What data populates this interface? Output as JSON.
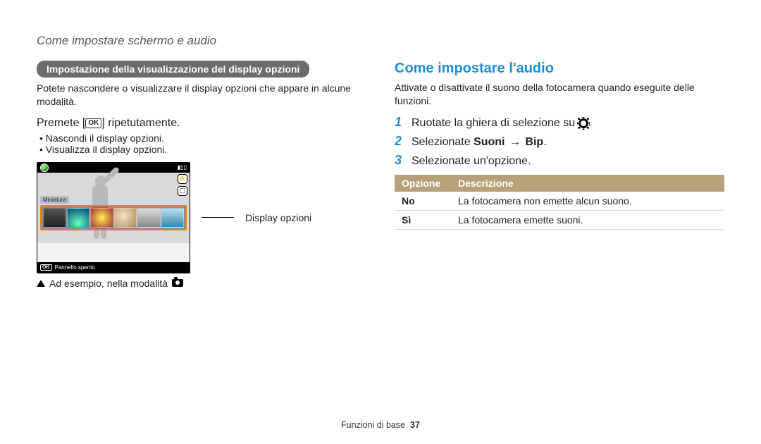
{
  "page_title": "Come impostare schermo e audio",
  "left": {
    "pill": "Impostazione della visualizzazione del display opzioni",
    "intro": "Potete nascondere o visualizzare il display opzioni che appare in alcune modalità.",
    "premete_prefix": "Premete [",
    "ok_label": "OK",
    "premete_suffix": "] ripetutamente.",
    "bullets": [
      "Nascondi il display opzioni.",
      "Visualizza il display opzioni."
    ],
    "screenshot": {
      "miniatura_label": "Miniatura",
      "bottom_ok": "OK",
      "bottom_text": "Pannello spento"
    },
    "callout_label": "Display opzioni",
    "caption_text": "Ad esempio, nella modalità"
  },
  "right": {
    "heading": "Come impostare l'audio",
    "intro": "Attivate o disattivate il suono della fotocamera quando eseguite delle funzioni.",
    "steps": {
      "s1_prefix": "Ruotate la ghiera di selezione su ",
      "s1_suffix": ".",
      "s2_prefix": "Selezionate ",
      "s2_bold_a": "Suoni",
      "s2_arrow": "→",
      "s2_bold_b": "Bip",
      "s2_suffix": ".",
      "s3": "Selezionate un'opzione."
    },
    "nums": {
      "n1": "1",
      "n2": "2",
      "n3": "3"
    },
    "table": {
      "th1": "Opzione",
      "th2": "Descrizione",
      "rows": [
        {
          "opt": "No",
          "desc": "La fotocamera non emette alcun suono."
        },
        {
          "opt": "Sì",
          "desc": "La fotocamera emette suoni."
        }
      ]
    }
  },
  "footer": {
    "label": "Funzioni di base",
    "page": "37"
  }
}
